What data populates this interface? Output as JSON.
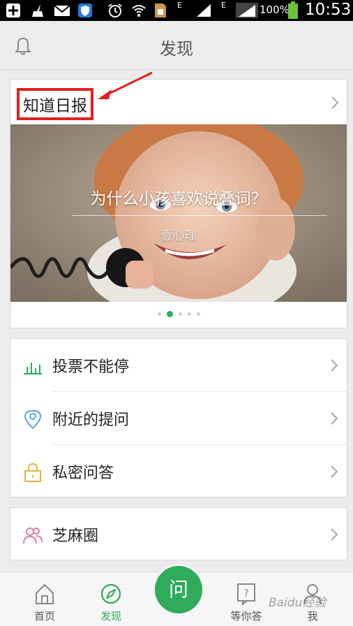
{
  "status_bar": {
    "battery_percent": "100%",
    "time": "10:53",
    "network_label_1": "E",
    "network_label_2": "E",
    "icons": [
      "add-icon",
      "broom-icon",
      "mail-icon",
      "shield-app-icon",
      "alarm-icon",
      "wifi-icon",
      "sim-icon",
      "signal-icon",
      "signal-icon",
      "battery-icon"
    ]
  },
  "header": {
    "title": "发现",
    "left_icon": "bell-icon"
  },
  "daily": {
    "title": "知道日报",
    "hero_title": "为什么小孩喜欢说叠词？",
    "hero_subtitle": "壹心理",
    "carousel_total": 5,
    "carousel_active_index": 1
  },
  "menu": {
    "items": [
      {
        "label": "投票不能停",
        "icon": "bar-chart-icon"
      },
      {
        "label": "附近的提问",
        "icon": "location-pin-icon"
      },
      {
        "label": "私密问答",
        "icon": "lock-icon"
      }
    ]
  },
  "circle": {
    "label": "芝麻圈",
    "icon": "people-icon"
  },
  "bottom_nav": {
    "items": [
      {
        "label": "首页",
        "icon": "home-icon"
      },
      {
        "label": "发现",
        "icon": "compass-icon"
      },
      {
        "label": "等你答",
        "icon": "question-doc-icon"
      },
      {
        "label": "我",
        "icon": "person-icon"
      }
    ],
    "center_button": "问"
  },
  "watermark": "Baidu经验",
  "colors": {
    "brand_green": "#2eab5b",
    "annotation_red": "#e02020"
  }
}
